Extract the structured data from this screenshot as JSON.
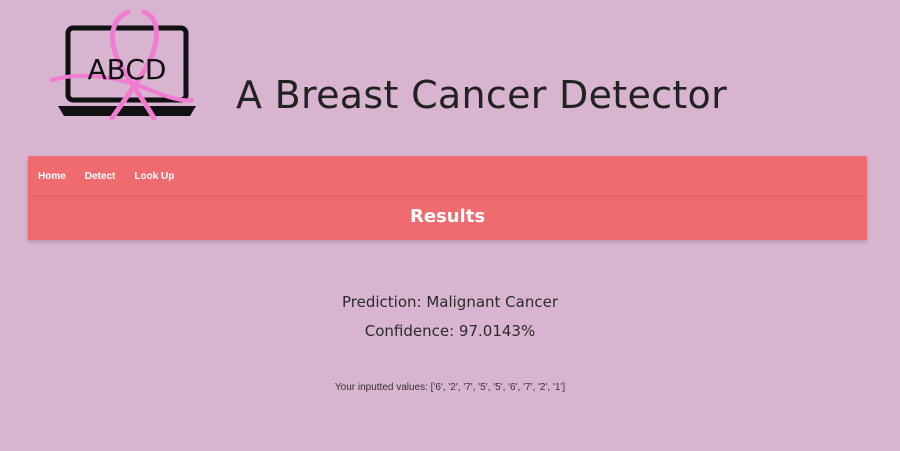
{
  "logo": {
    "text": "ABCD",
    "icon": "laptop-ribbon-icon",
    "colors": {
      "laptop": "#111111",
      "ribbon": "#f07bd0"
    }
  },
  "header": {
    "title": "A Breast Cancer Detector"
  },
  "nav": {
    "items": [
      {
        "label": "Home"
      },
      {
        "label": "Detect"
      },
      {
        "label": "Look Up"
      }
    ]
  },
  "section": {
    "title": "Results"
  },
  "results": {
    "prediction": "Prediction: Malignant Cancer",
    "confidence": "Confidence: 97.0143%",
    "inputs": "Your inputted values: ['6', '2', '7', '5', '5', '6', '7', '2', '1']"
  },
  "colors": {
    "background": "#d8b4d1",
    "nav": "#ef6b6f",
    "nav_text": "#ffffff"
  }
}
